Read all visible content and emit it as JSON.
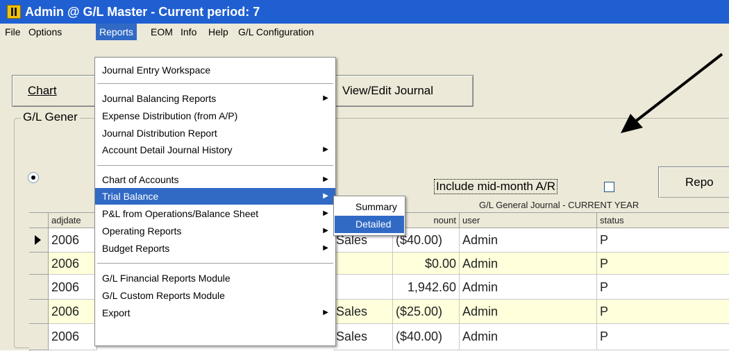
{
  "window": {
    "title": "Admin @ G/L Master - Current period: 7"
  },
  "menubar": {
    "items": [
      {
        "label": "File"
      },
      {
        "label": "Options"
      },
      {
        "label": "Reports"
      },
      {
        "label": "EOM"
      },
      {
        "label": "Info"
      },
      {
        "label": "Help"
      },
      {
        "label": "G/L Configuration"
      }
    ]
  },
  "toolbar": {
    "chart_label": "Chart",
    "view_edit_label": "View/Edit Journal"
  },
  "group": {
    "label": "G/L Gener"
  },
  "options": {
    "include_label": "Include mid-month A/R",
    "include_checked": false
  },
  "report_button": {
    "label": "Repo"
  },
  "grid": {
    "caption": "G/L General Journal - CURRENT YEAR",
    "headers": {
      "adjdate": "adjdate",
      "amount": "nount",
      "user": "user",
      "status": "status"
    },
    "rows": [
      {
        "date": "2006",
        "desc": "Sales",
        "amount": "($40.00)",
        "user": "Admin",
        "status": "P"
      },
      {
        "date": "2006",
        "desc": "",
        "amount": "$0.00",
        "user": "Admin",
        "status": "P"
      },
      {
        "date": "2006",
        "desc": "",
        "amount": "1,942.60",
        "user": "Admin",
        "status": "P"
      },
      {
        "date": "2006",
        "desc": "Sales",
        "amount": "($25.00)",
        "user": "Admin",
        "status": "P"
      },
      {
        "date": "2006",
        "desc": "Sales",
        "amount": "($40.00)",
        "user": "Admin",
        "status": "P"
      }
    ]
  },
  "reports_menu": {
    "items": [
      {
        "label": "Journal Entry Workspace"
      },
      {
        "label": "Journal Balancing Reports"
      },
      {
        "label": "Expense Distribution (from A/P)"
      },
      {
        "label": "Journal Distribution Report"
      },
      {
        "label": "Account Detail Journal History"
      },
      {
        "label": "Chart of Accounts"
      },
      {
        "label": "Trial Balance"
      },
      {
        "label": "P&L from Operations/Balance Sheet"
      },
      {
        "label": "Operating Reports"
      },
      {
        "label": "Budget Reports"
      },
      {
        "label": "G/L Financial Reports Module"
      },
      {
        "label": "G/L Custom Reports Module"
      },
      {
        "label": "Export"
      }
    ]
  },
  "submenu": {
    "items": [
      {
        "label": "Summary"
      },
      {
        "label": "Detailed"
      }
    ]
  },
  "colors": {
    "titlebar": "#1f5fd1",
    "highlight": "#316ac5",
    "window_bg": "#ece9d8",
    "row_yellow": "#ffffdc"
  }
}
